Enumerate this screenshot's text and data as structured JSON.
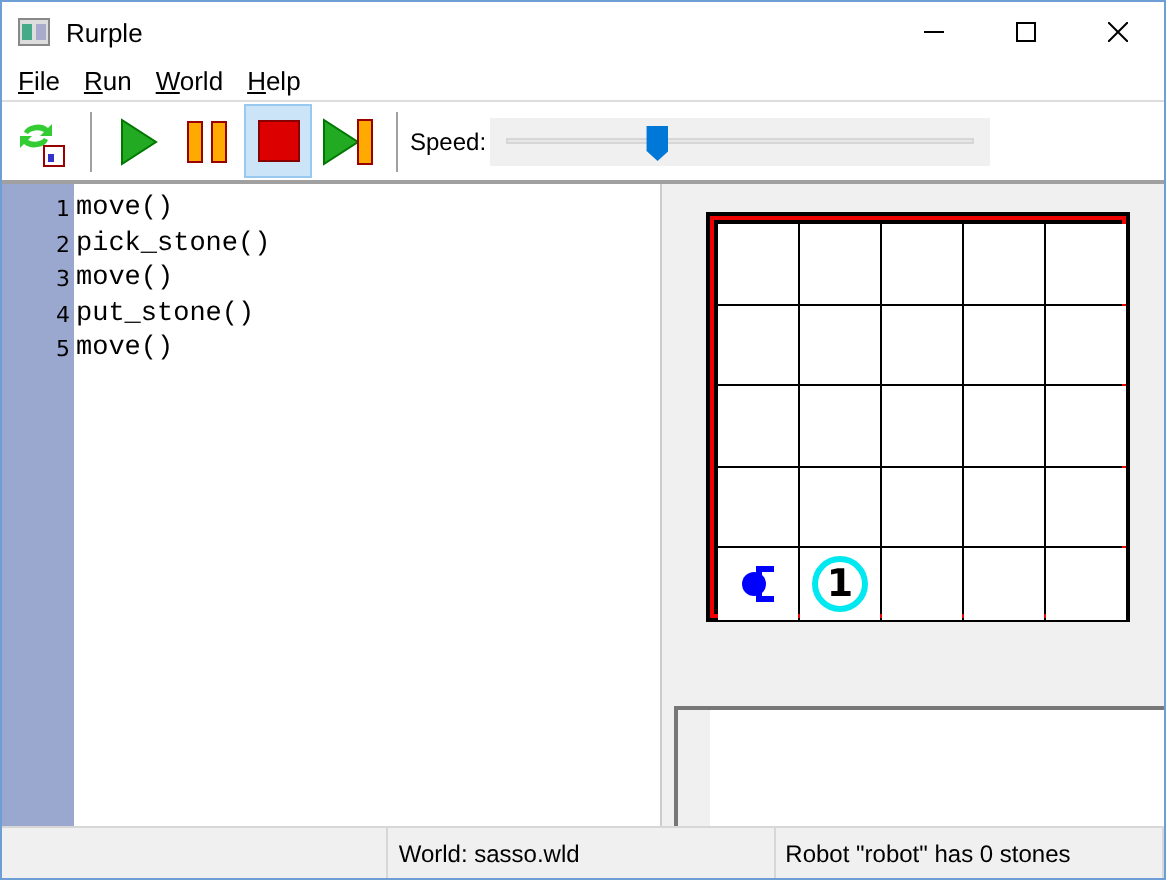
{
  "window": {
    "title": "Rurple"
  },
  "menu": [
    {
      "label": "File"
    },
    {
      "label": "Run"
    },
    {
      "label": "World"
    },
    {
      "label": "Help"
    }
  ],
  "toolbar": {
    "buttons": [
      {
        "kind": "reload",
        "selected": false
      },
      {
        "kind": "run",
        "selected": false
      },
      {
        "kind": "pause",
        "selected": false
      },
      {
        "kind": "stop",
        "selected": true
      },
      {
        "kind": "step",
        "selected": false
      }
    ],
    "speed": {
      "label": "Speed:",
      "level": 0.32
    }
  },
  "editor": {
    "lines": [
      {
        "number": "1",
        "code": "move()"
      },
      {
        "number": "2",
        "code": "pick_stone()"
      },
      {
        "number": "3",
        "code": "move()"
      },
      {
        "number": "4",
        "code": "put_stone()"
      },
      {
        "number": "5",
        "code": "move()"
      }
    ]
  },
  "world": {
    "rows": [
      [
        {
          "kind": "empty"
        },
        {
          "kind": "empty"
        },
        {
          "kind": "empty"
        },
        {
          "kind": "empty"
        },
        {
          "kind": "empty"
        }
      ],
      [
        {
          "kind": "empty"
        },
        {
          "kind": "empty"
        },
        {
          "kind": "empty"
        },
        {
          "kind": "empty"
        },
        {
          "kind": "empty"
        }
      ],
      [
        {
          "kind": "empty"
        },
        {
          "kind": "empty"
        },
        {
          "kind": "empty"
        },
        {
          "kind": "empty"
        },
        {
          "kind": "empty"
        }
      ],
      [
        {
          "kind": "empty"
        },
        {
          "kind": "empty"
        },
        {
          "kind": "empty"
        },
        {
          "kind": "empty"
        },
        {
          "kind": "empty"
        }
      ],
      [
        {
          "kind": "robot"
        },
        {
          "kind": "stone",
          "count": "1"
        },
        {
          "kind": "empty"
        },
        {
          "kind": "empty"
        },
        {
          "kind": "empty"
        }
      ]
    ]
  },
  "status_bar": [
    "World: sasso.wld",
    "Robot \"robot\" has 0 stones"
  ]
}
